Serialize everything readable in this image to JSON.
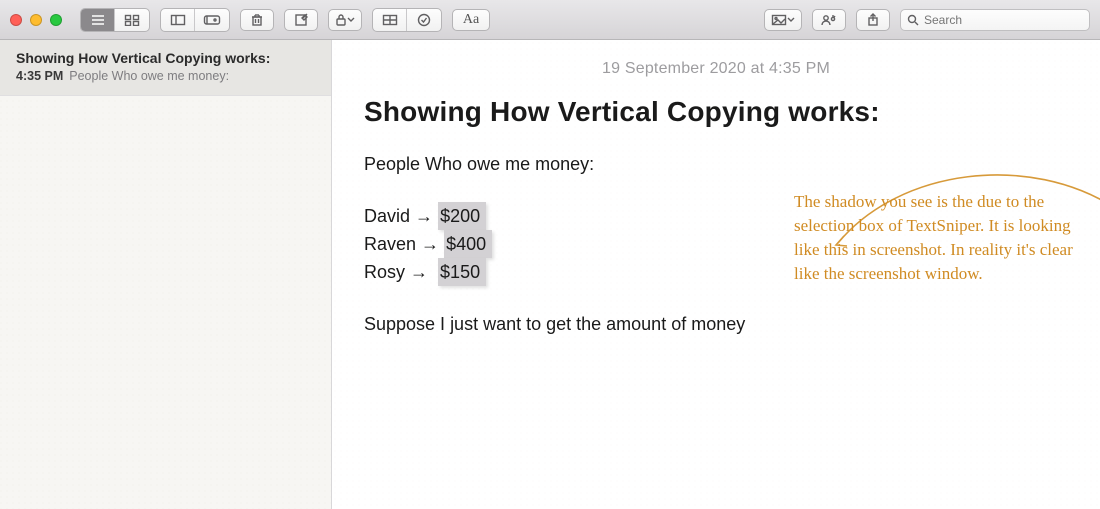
{
  "search": {
    "placeholder": "Search"
  },
  "sidebar": {
    "items": [
      {
        "title": "Showing How Vertical Copying works:",
        "time": "4:35 PM",
        "preview": "People Who owe me money:"
      }
    ]
  },
  "note": {
    "date": "19 September 2020 at 4:35 PM",
    "title": "Showing How Vertical Copying works:",
    "subtitle": "People Who owe me money:",
    "rows": [
      {
        "name": "David",
        "arrow": "→",
        "amount": "$200"
      },
      {
        "name": "Raven",
        "arrow": "→",
        "amount": "$400"
      },
      {
        "name": "Rosy",
        "arrow": "→",
        "amount": "$150"
      }
    ],
    "footer": "Suppose I just want to get the amount of money"
  },
  "annotation": "The shadow you see is the due to the selection box of TextSniper. It is looking like this in screenshot. In reality it's clear like the screenshot window."
}
